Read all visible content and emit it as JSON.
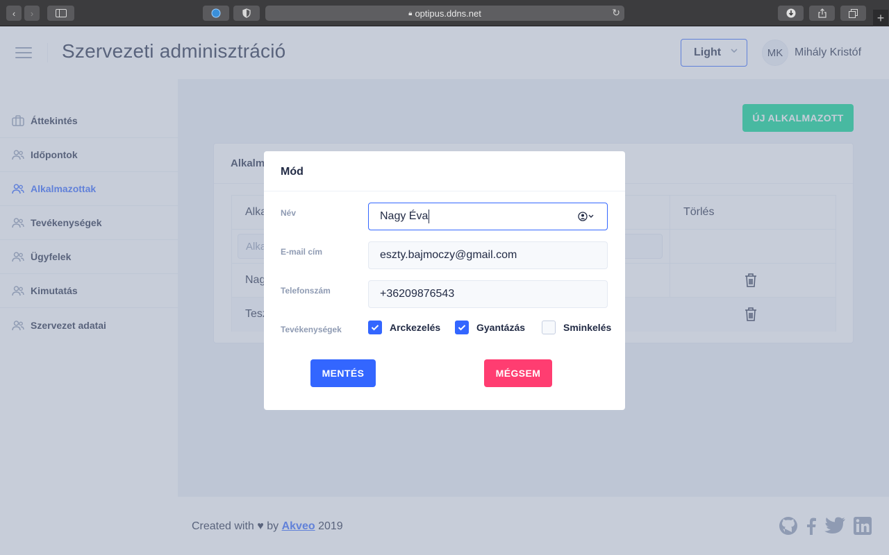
{
  "browser": {
    "url": "optipus.ddns.net"
  },
  "header": {
    "title": "Szervezeti adminisztráció",
    "theme": "Light",
    "user_initials": "MK",
    "user_name": "Mihály Kristóf"
  },
  "sidebar": {
    "items": [
      {
        "label": "Áttekintés",
        "icon": "briefcase-icon"
      },
      {
        "label": "Időpontok",
        "icon": "people-icon"
      },
      {
        "label": "Alkalmazottak",
        "icon": "people-icon",
        "active": true
      },
      {
        "label": "Tevékenységek",
        "icon": "people-icon"
      },
      {
        "label": "Ügyfelek",
        "icon": "people-icon"
      },
      {
        "label": "Kimutatás",
        "icon": "people-icon"
      },
      {
        "label": "Szervezet adatai",
        "icon": "people-icon"
      }
    ]
  },
  "main": {
    "new_button": "ÚJ ALKALMAZOTT",
    "card_title": "Alkalm",
    "table": {
      "col_name_header": "Alka",
      "col_delete_header": "Törlés",
      "filter_placeholder": "Alka",
      "rows": [
        "Nag",
        "Tesz"
      ]
    }
  },
  "modal": {
    "title": "Mód",
    "name_label": "Név",
    "name_value": "Nagy Éva",
    "email_label": "E-mail cím",
    "email_value": "eszty.bajmoczy@gmail.com",
    "phone_label": "Telefonszám",
    "phone_value": "+36209876543",
    "activities_label": "Tevékenységek",
    "activities": [
      {
        "label": "Arckezelés",
        "checked": true
      },
      {
        "label": "Gyantázás",
        "checked": true
      },
      {
        "label": "Sminkelés",
        "checked": false
      }
    ],
    "save_label": "MENTÉS",
    "cancel_label": "MÉGSEM"
  },
  "footer": {
    "prefix": "Created with",
    "by": "by",
    "brand": "Akveo",
    "year": "2019"
  },
  "colors": {
    "primary": "#3366ff",
    "success": "#00d68f",
    "danger": "#ff3d71",
    "text": "#222b45",
    "hint": "#8f9bb3"
  }
}
